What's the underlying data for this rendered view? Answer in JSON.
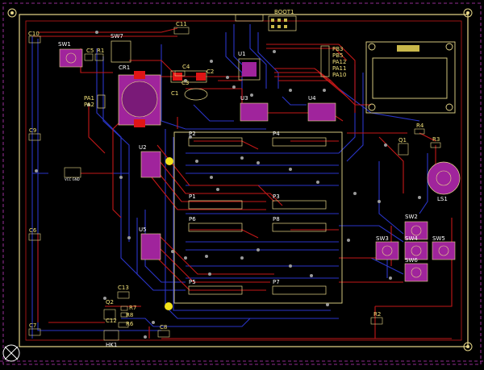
{
  "colors": {
    "background": "#000000",
    "board_outline": "#e8d98a",
    "outer_edge": "#c03cc0",
    "top_copper": "#c41818",
    "bottom_copper": "#2a35c8",
    "silkscreen": "#f3e27a",
    "pad": "#c9b84a",
    "component_body": "#a0249c",
    "via": "#9a9a9a"
  },
  "labels": {
    "boot": "BOOT1",
    "pins_pb": [
      "PB3",
      "PB5",
      "PA12",
      "PA11",
      "PA10"
    ],
    "pins_pa": [
      "PA1",
      "PA2"
    ],
    "components": [
      "C10",
      "SW1",
      "SW7",
      "C5",
      "R1",
      "C11",
      "U1",
      "CR1",
      "C4",
      "C3",
      "C2",
      "C1",
      "U3",
      "U4",
      "U2",
      "U5",
      "P1",
      "P2",
      "P3",
      "P4",
      "P5",
      "P6",
      "P7",
      "P8",
      "C9",
      "C6",
      "C7",
      "C8",
      "C12",
      "C13",
      "Q2",
      "R6",
      "R7",
      "R8",
      "HK1",
      "R2",
      "R3",
      "R4",
      "Q1",
      "LS1",
      "SW2",
      "SW3",
      "SW4",
      "SW5",
      "SW6"
    ],
    "header_pin_label": "VCC GND"
  },
  "icons": [
    "mounting-hole-icon",
    "origin-marker-icon"
  ]
}
